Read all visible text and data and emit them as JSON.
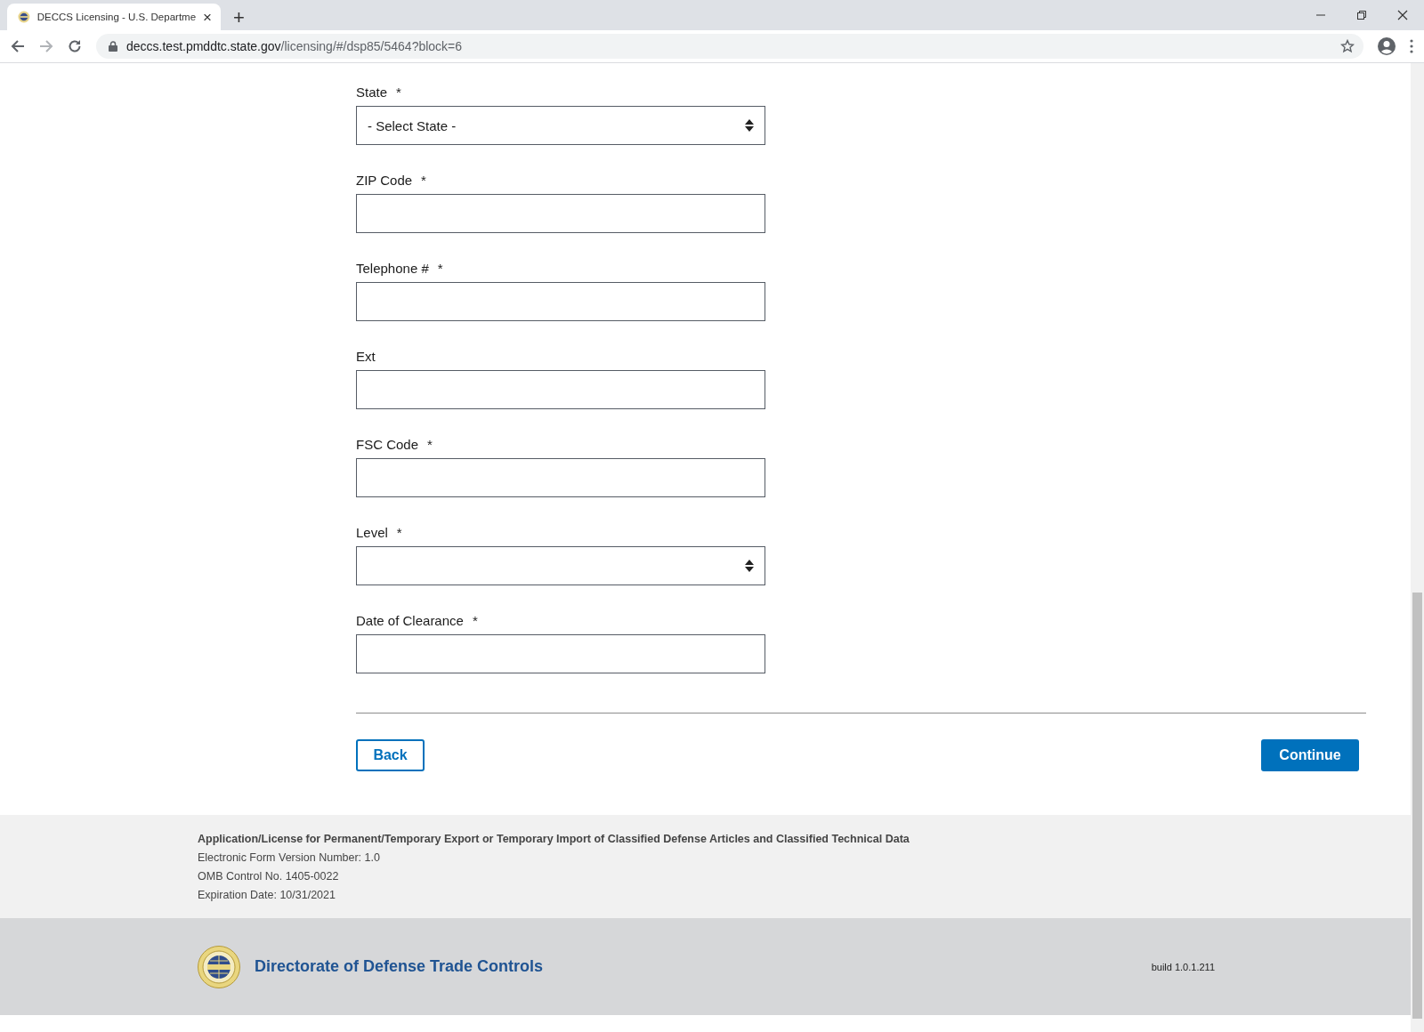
{
  "browser": {
    "tab_title": "DECCS Licensing - U.S. Departme",
    "tab_close": "×",
    "new_tab": "+",
    "url_host": "deccs.test.pmddtc.state.gov",
    "url_path": "/licensing/#/dsp85/5464?block=6"
  },
  "fields": [
    {
      "kind": "select",
      "label": "State",
      "required_mark": "*",
      "value": "- Select State -"
    },
    {
      "kind": "text",
      "label": "ZIP Code",
      "required_mark": "*"
    },
    {
      "kind": "text",
      "label": "Telephone #",
      "required_mark": "*"
    },
    {
      "kind": "text",
      "label": "Ext"
    },
    {
      "kind": "text",
      "label": "FSC Code",
      "required_mark": "*"
    },
    {
      "kind": "select",
      "label": "Level",
      "required_mark": "*"
    },
    {
      "kind": "text",
      "label": "Date of Clearance",
      "required_mark": "*"
    }
  ],
  "buttons": [
    {
      "kind": "secondary",
      "label": "Back"
    },
    {
      "kind": "primary",
      "label": "Continue"
    }
  ],
  "form_info": {
    "title": "Application/License for Permanent/Temporary Export or Temporary Import of Classified Defense Articles and Classified Technical Data",
    "lines": [
      "Electronic Form Version Number: 1.0",
      "OMB Control No. 1405-0022",
      "Expiration Date: 10/31/2021"
    ]
  },
  "footer": {
    "agency": "Directorate of Defense Trade Controls",
    "build": "build 1.0.1.211"
  }
}
